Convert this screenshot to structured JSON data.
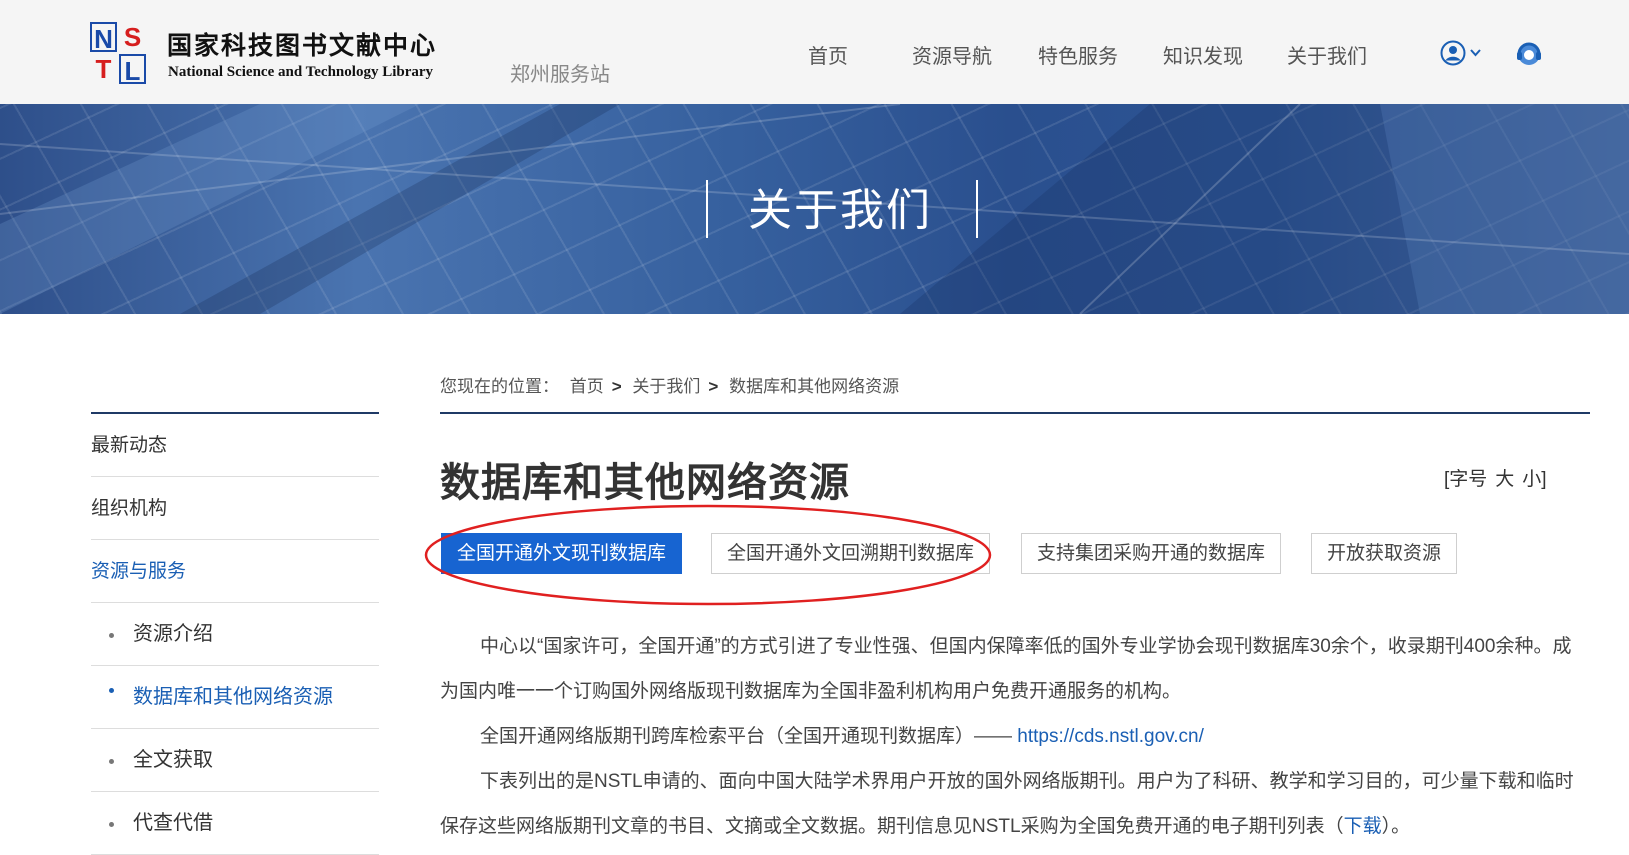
{
  "header": {
    "logo_letters": [
      "N",
      "S",
      "T",
      "L"
    ],
    "org_name_cn": "国家科技图书文献中心",
    "org_name_en": "National Science and Technology Library",
    "station": "郑州服务站",
    "nav": [
      "首页",
      "资源导航",
      "特色服务",
      "知识发现",
      "关于我们"
    ],
    "icons": [
      "user-icon",
      "chevron-down-icon",
      "help-icon"
    ]
  },
  "banner": {
    "title": "关于我们"
  },
  "breadcrumb": {
    "prefix": "您现在的位置：",
    "items": [
      "首页",
      "关于我们",
      "数据库和其他网络资源"
    ],
    "separator": ">"
  },
  "sidebar": {
    "items": [
      {
        "label": "最新动态",
        "active": false
      },
      {
        "label": "组织机构",
        "active": false
      },
      {
        "label": "资源与服务",
        "active": true
      }
    ],
    "subitems": [
      {
        "label": "资源介绍",
        "active": false
      },
      {
        "label": "数据库和其他网络资源",
        "active": true
      },
      {
        "label": "全文获取",
        "active": false
      },
      {
        "label": "代查代借",
        "active": false
      }
    ]
  },
  "main": {
    "title": "数据库和其他网络资源",
    "font_size": {
      "label": "[字号",
      "large": "大",
      "small": "小]"
    },
    "tabs": [
      {
        "label": "全国开通外文现刊数据库",
        "active": true
      },
      {
        "label": "全国开通外文回溯期刊数据库",
        "active": false
      },
      {
        "label": "支持集团采购开通的数据库",
        "active": false
      },
      {
        "label": "开放获取资源",
        "active": false
      }
    ],
    "para1": "中心以“国家许可，全国开通”的方式引进了专业性强、但国内保障率低的国外专业学协会现刊数据库30余个，收录期刊400余种。成为国内唯一一个订购国外网络版现刊数据库为全国非盈利机构用户免费开通服务的机构。",
    "para2_text": "全国开通网络版期刊跨库检索平台（全国开通现刊数据库）——",
    "para2_link": "https://cds.nstl.gov.cn/",
    "para3_text": "下表列出的是NSTL申请的、面向中国大陆学术界用户开放的国外网络版期刊。用户为了科研、教学和学习目的，可少量下载和临时保存这些网络版期刊文章的书目、文摘或全文数据。期刊信息见NSTL采购为全国免费开通的电子期刊列表（",
    "para3_link": "下载",
    "para3_end": "）。"
  },
  "colors": {
    "accent": "#1764d1",
    "link": "#1a5fb4",
    "annotation": "#e02020",
    "rule": "#1f3a66"
  }
}
